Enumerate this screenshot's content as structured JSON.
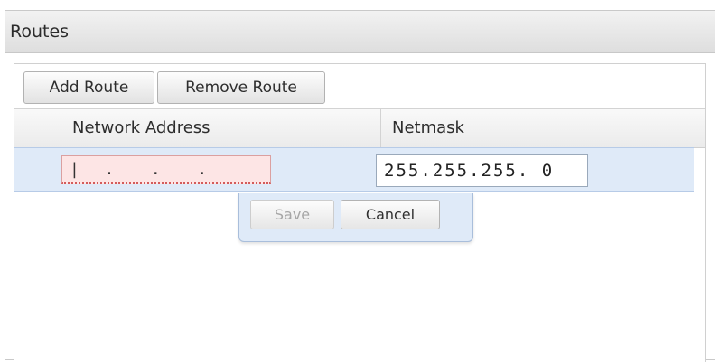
{
  "panel": {
    "title": "Routes"
  },
  "toolbar": {
    "add_route_label": "Add Route",
    "remove_route_label": "Remove Route"
  },
  "table": {
    "columns": [
      "Network Address",
      "Netmask"
    ]
  },
  "edit_row": {
    "network_address_value": "|  .   .   .",
    "netmask_value": "255.255.255. 0",
    "network_address_invalid": true
  },
  "edit_actions": {
    "save_label": "Save",
    "save_disabled": true,
    "cancel_label": "Cancel"
  },
  "colors": {
    "selected_row": "#dfeaf8",
    "invalid_field": "#fde5e5",
    "invalid_underline": "#d35b5b"
  }
}
